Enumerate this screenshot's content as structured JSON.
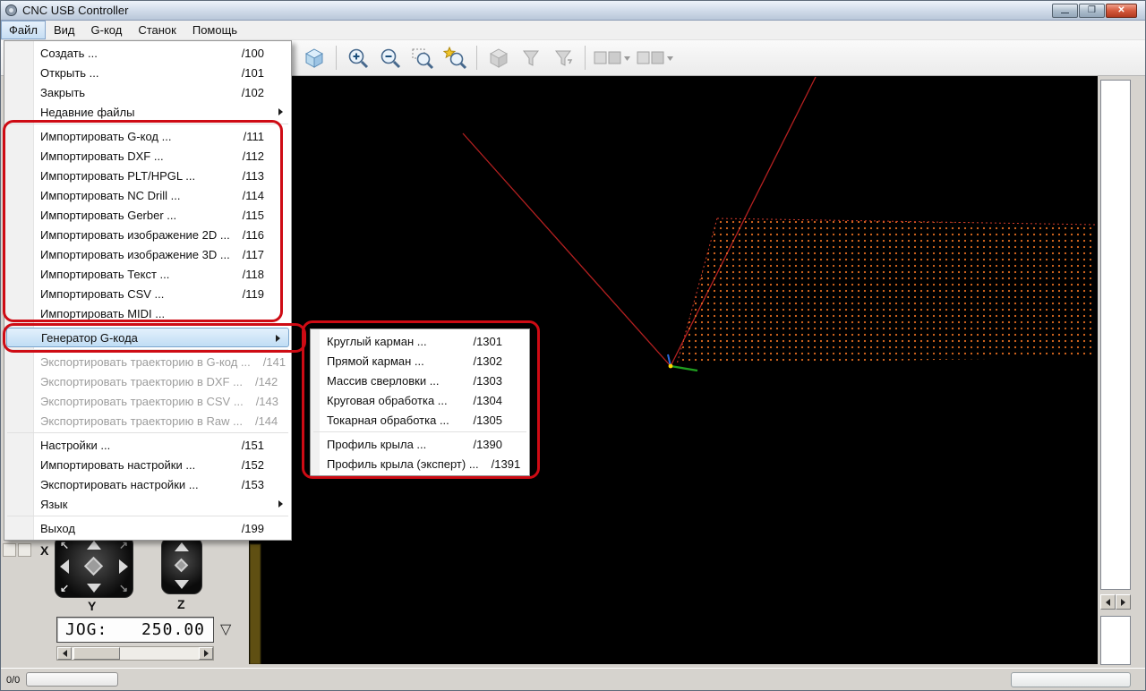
{
  "window": {
    "title": "CNC USB Controller"
  },
  "menubar": {
    "items": [
      {
        "label": "Файл",
        "active": true
      },
      {
        "label": "Вид"
      },
      {
        "label": "G-код"
      },
      {
        "label": "Станок"
      },
      {
        "label": "Помощь"
      }
    ]
  },
  "file_menu": {
    "items": [
      {
        "label": "Создать ...",
        "shortcut": "/100"
      },
      {
        "label": "Открыть ...",
        "shortcut": "/101"
      },
      {
        "label": "Закрыть",
        "shortcut": "/102"
      },
      {
        "label": "Недавние файлы",
        "submenu": true
      },
      {
        "type": "separator"
      },
      {
        "label": "Импортировать G-код ...",
        "shortcut": "/111"
      },
      {
        "label": "Импортировать DXF ...",
        "shortcut": "/112"
      },
      {
        "label": "Импортировать PLT/HPGL ...",
        "shortcut": "/113"
      },
      {
        "label": "Импортировать NC Drill ...",
        "shortcut": "/114"
      },
      {
        "label": "Импортировать Gerber ...",
        "shortcut": "/115"
      },
      {
        "label": "Импортировать изображение 2D ...",
        "shortcut": "/116"
      },
      {
        "label": "Импортировать изображение 3D ...",
        "shortcut": "/117"
      },
      {
        "label": "Импортировать Текст ...",
        "shortcut": "/118"
      },
      {
        "label": "Импортировать CSV ...",
        "shortcut": "/119"
      },
      {
        "label": "Импортировать MIDI ..."
      },
      {
        "type": "separator"
      },
      {
        "label": "Генератор G-кода",
        "submenu": true,
        "highlighted": true
      },
      {
        "type": "separator"
      },
      {
        "label": "Экспортировать траекторию в G-код ...",
        "shortcut": "/141",
        "disabled": true
      },
      {
        "label": "Экспортировать траекторию в DXF ...",
        "shortcut": "/142",
        "disabled": true
      },
      {
        "label": "Экспортировать траекторию в CSV ...",
        "shortcut": "/143",
        "disabled": true
      },
      {
        "label": "Экспортировать траекторию в Raw ...",
        "shortcut": "/144",
        "disabled": true
      },
      {
        "type": "separator"
      },
      {
        "label": "Настройки ...",
        "shortcut": "/151"
      },
      {
        "label": "Импортировать настройки ...",
        "shortcut": "/152"
      },
      {
        "label": "Экспортировать настройки ...",
        "shortcut": "/153"
      },
      {
        "label": "Язык",
        "submenu": true
      },
      {
        "type": "separator"
      },
      {
        "label": "Выход",
        "shortcut": "/199"
      }
    ]
  },
  "gcode_generator_submenu": {
    "items": [
      {
        "label": "Круглый карман ...",
        "shortcut": "/1301"
      },
      {
        "label": "Прямой карман ...",
        "shortcut": "/1302"
      },
      {
        "label": "Массив сверловки ...",
        "shortcut": "/1303"
      },
      {
        "label": "Круговая обработка ...",
        "shortcut": "/1304"
      },
      {
        "label": "Токарная обработка ...",
        "shortcut": "/1305"
      },
      {
        "type": "separator"
      },
      {
        "label": "Профиль крыла ...",
        "shortcut": "/1390"
      },
      {
        "label": "Профиль крыла (эксперт) ...",
        "shortcut": "/1391"
      }
    ]
  },
  "toolbar": {
    "icons": [
      "view-3d-cube",
      "zoom-in",
      "zoom-out",
      "zoom-window",
      "zoom-tool",
      "simulate (disabled)",
      "filter-toolpath (disabled)",
      "filter-toolpath-2 (disabled)",
      "transform-group-1 (disabled)",
      "transform-group-2 (disabled)"
    ]
  },
  "jog": {
    "x_label": "X",
    "y_label": "Y",
    "z_label": "Z",
    "jog_label": "JOG:",
    "jog_value": "250.00"
  },
  "status": {
    "counter": "0/0"
  },
  "colors": {
    "annotation_red": "#ce0b14",
    "menu_highlight_border": "#79a5cd",
    "viewport_background": "#000000",
    "toolpath_line_red": "#b32020",
    "grid_dot_orange": "#e06a20",
    "axis_green": "#1f9e1f",
    "close_button_red": "#d4593c"
  }
}
